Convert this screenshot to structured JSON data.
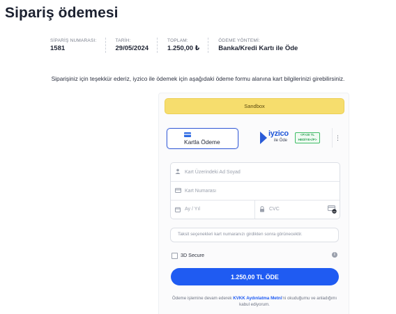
{
  "page": {
    "title": "Sipariş ödemesi"
  },
  "order_summary": [
    {
      "label": "SİPARİŞ NUMARASI:",
      "value": "1581"
    },
    {
      "label": "TARİH:",
      "value": "29/05/2024"
    },
    {
      "label": "TOPLAM:",
      "value": "1.250,00 ₺"
    },
    {
      "label": "ÖDEME YÖNTEMİ:",
      "value": "Banka/Kredi Kartı ile Öde"
    }
  ],
  "thanks_message": "Siparişiniz için teşekkür ederiz, iyzico ile ödemek için aşağıdaki ödeme formu alanına kart bilgilerinizi girebilirsiniz.",
  "payment_form": {
    "sandbox_label": "Sandbox",
    "tabs": {
      "card_label": "Kartla Ödeme",
      "iyzico_logo": "iyzico",
      "iyzico_sub": "ile Öde",
      "promo_line1": "<P>20 TL",
      "promo_line2": "HEDİYE</P>",
      "more": "⋮"
    },
    "fields": {
      "name_placeholder": "Kart Üzerindeki Ad Soyad",
      "number_placeholder": "Kart Numarası",
      "expiry_placeholder": "Ay / Yıl",
      "cvc_placeholder": "CVC"
    },
    "installment_text": "Taksit seçenekleri kart numaranızı girdikten sonra görünecektir.",
    "secure_label": "3D Secure",
    "pay_button": "1.250,00 TL ÖDE",
    "consent": {
      "prefix": "Ödeme işlemine devam ederek ",
      "link": "KVKK Aydınlatma Metni",
      "suffix": "'ni okuduğumu ve anladığımı kabul ediyorum."
    }
  }
}
